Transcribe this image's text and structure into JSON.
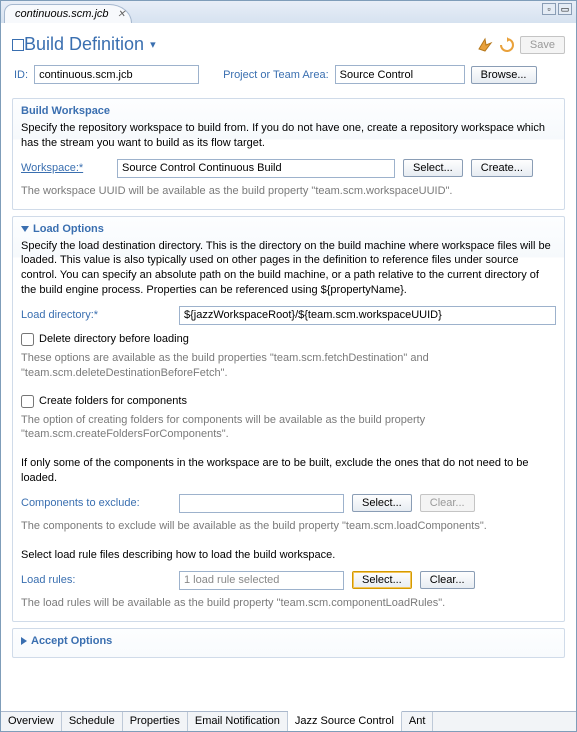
{
  "tab": {
    "title": "continuous.scm.jcb"
  },
  "header": {
    "title": "Build Definition",
    "saveLabel": "Save"
  },
  "idRow": {
    "idLabel": "ID:",
    "idValue": "continuous.scm.jcb",
    "projLabel": "Project or Team Area:",
    "projValue": "Source Control",
    "browse": "Browse..."
  },
  "buildWorkspace": {
    "title": "Build Workspace",
    "desc": "Specify the repository workspace to build from. If you do not have one, create a repository workspace which has the stream you want to build as its flow target.",
    "wsLabel": "Workspace:*",
    "wsValue": "Source Control Continuous Build",
    "select": "Select...",
    "create": "Create...",
    "hint": "The workspace UUID will be available as the build property \"team.scm.workspaceUUID\"."
  },
  "loadOptions": {
    "title": "Load Options",
    "desc": "Specify the load destination directory. This is the directory on the build machine where workspace files will be loaded. This value is also typically used on other pages in the definition to reference files under source control. You can specify an absolute path on the build machine, or a path relative to the current directory of the build engine process. Properties can be referenced using ${propertyName}.",
    "loadDirLabel": "Load directory:*",
    "loadDirValue": "${jazzWorkspaceRoot}/${team.scm.workspaceUUID}",
    "deleteChk": "Delete directory before loading",
    "deleteHint": "These options are available as the build properties \"team.scm.fetchDestination\" and \"team.scm.deleteDestinationBeforeFetch\".",
    "createFoldersChk": "Create folders for components",
    "createFoldersHint": "The option of creating folders for components will be available as the build property \"team.scm.createFoldersForComponents\".",
    "excludeDesc": "If only some of the components in the workspace are to be built, exclude the ones that do not need to be loaded.",
    "componentsLabel": "Components to exclude:",
    "select": "Select...",
    "clear": "Clear...",
    "componentsHint": "The components to exclude will be available as the build property \"team.scm.loadComponents\".",
    "loadRulesDesc": "Select load rule files describing how to load the build workspace.",
    "loadRulesLabel": "Load rules:",
    "loadRulesValue": "1 load rule selected",
    "loadRulesHint": "The load rules will be available as the build property \"team.scm.componentLoadRules\"."
  },
  "acceptOptions": {
    "title": "Accept Options"
  },
  "bottomTabs": {
    "overview": "Overview",
    "schedule": "Schedule",
    "properties": "Properties",
    "email": "Email Notification",
    "jazz": "Jazz Source Control",
    "ant": "Ant"
  }
}
